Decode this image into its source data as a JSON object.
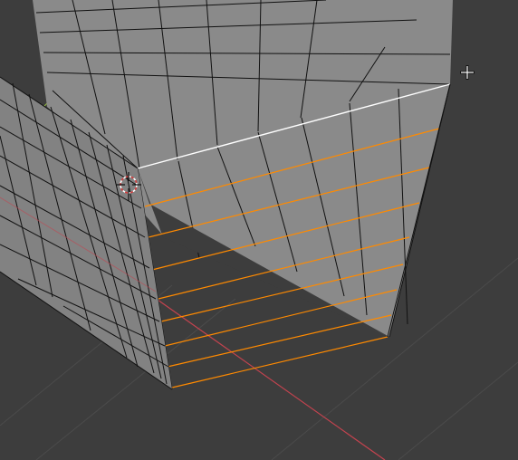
{
  "viewport": {
    "background": "#3d3d3d",
    "grid_color": "#4a4a4a",
    "axis_x_color": "#c5434f",
    "axis_y_color": "#8cb33d",
    "face_color": "#8a8a8a",
    "face_shade_color": "#7e7e7e",
    "wire_color": "#111111",
    "selected_edge_color": "#ffffff",
    "loop_edge_color": "#ff8a00",
    "cursor_3d_icon": "3d-cursor-icon",
    "mouse_cursor_icon": "crosshair-cursor-icon"
  }
}
